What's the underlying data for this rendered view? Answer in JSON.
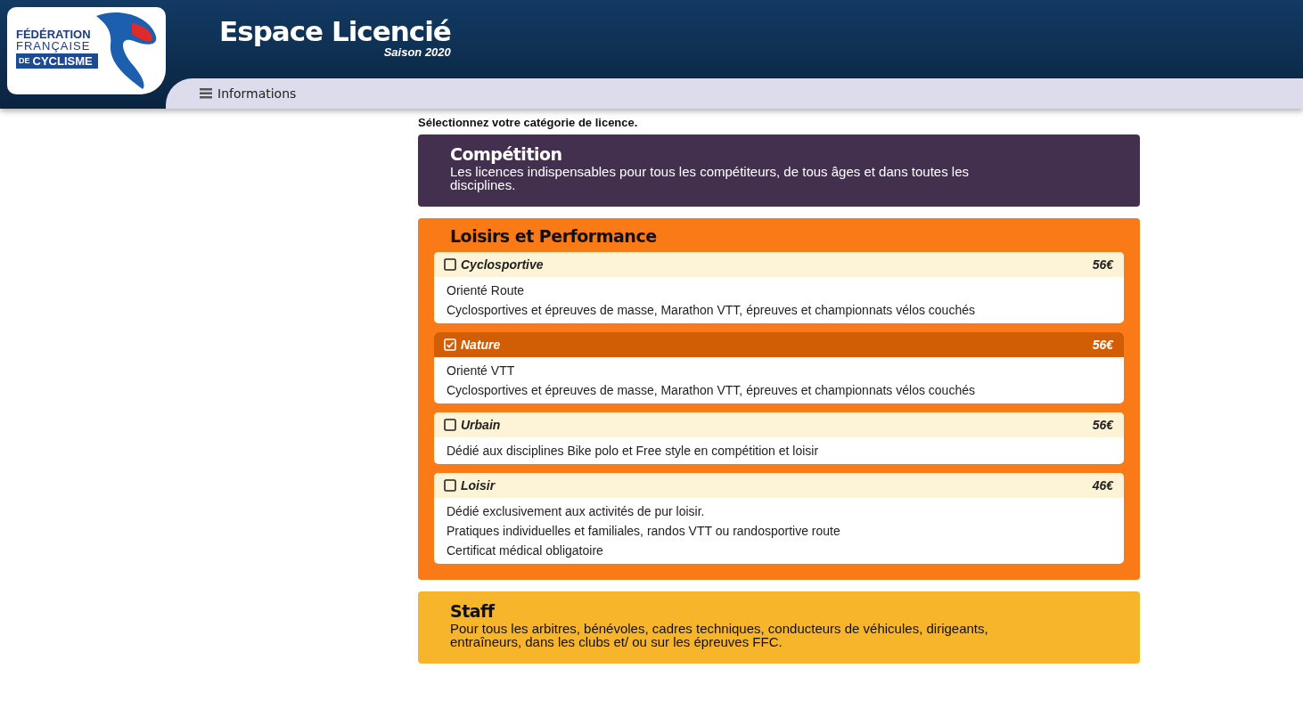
{
  "header": {
    "logo": {
      "line_1": "FÉDÉRATION",
      "line_2": "FRANÇAISE",
      "line_3_prefix": "DE",
      "line_3": "CYCLISME"
    },
    "title": "Espace Licencié",
    "subtitle": "Saison 2020",
    "nav": [
      {
        "label": "Informations"
      }
    ]
  },
  "intro": "Sélectionnez votre catégorie de licence.",
  "categories": [
    {
      "kind": "banner",
      "title": "Compétition",
      "color": "#43304f",
      "description": "Les licences indispensables pour tous les compétiteurs, de tous âges et dans toutes les disciplines."
    },
    {
      "kind": "options",
      "title": "Loisirs et Performance",
      "color": "#f97a16",
      "options": [
        {
          "name": "Cyclosportive",
          "price": "56€",
          "checked": false,
          "lines": [
            "Orienté Route",
            "Cyclosportives et épreuves de masse, Marathon VTT, épreuves et championnats vélos couchés"
          ]
        },
        {
          "name": "Nature",
          "price": "56€",
          "checked": true,
          "lines": [
            "Orienté VTT",
            "Cyclosportives et épreuves de masse, Marathon VTT, épreuves et championnats vélos couchés"
          ]
        },
        {
          "name": "Urbain",
          "price": "56€",
          "checked": false,
          "lines": [
            "Dédié aux disciplines Bike polo et Free style en compétition et loisir"
          ]
        },
        {
          "name": "Loisir",
          "price": "46€",
          "checked": false,
          "lines": [
            "Dédié exclusivement aux activités de pur loisir.",
            "Pratiques individuelles et familiales, randos VTT ou randosportive route",
            "Certificat médical obligatoire"
          ]
        }
      ]
    },
    {
      "kind": "banner",
      "title": "Staff",
      "color": "#f7b52b",
      "dark_text": true,
      "description": "Pour tous les arbitres, bénévoles, cadres techniques, conducteurs de véhicules, dirigeants, entraîneurs, dans les clubs et/ ou sur les épreuves FFC."
    }
  ]
}
